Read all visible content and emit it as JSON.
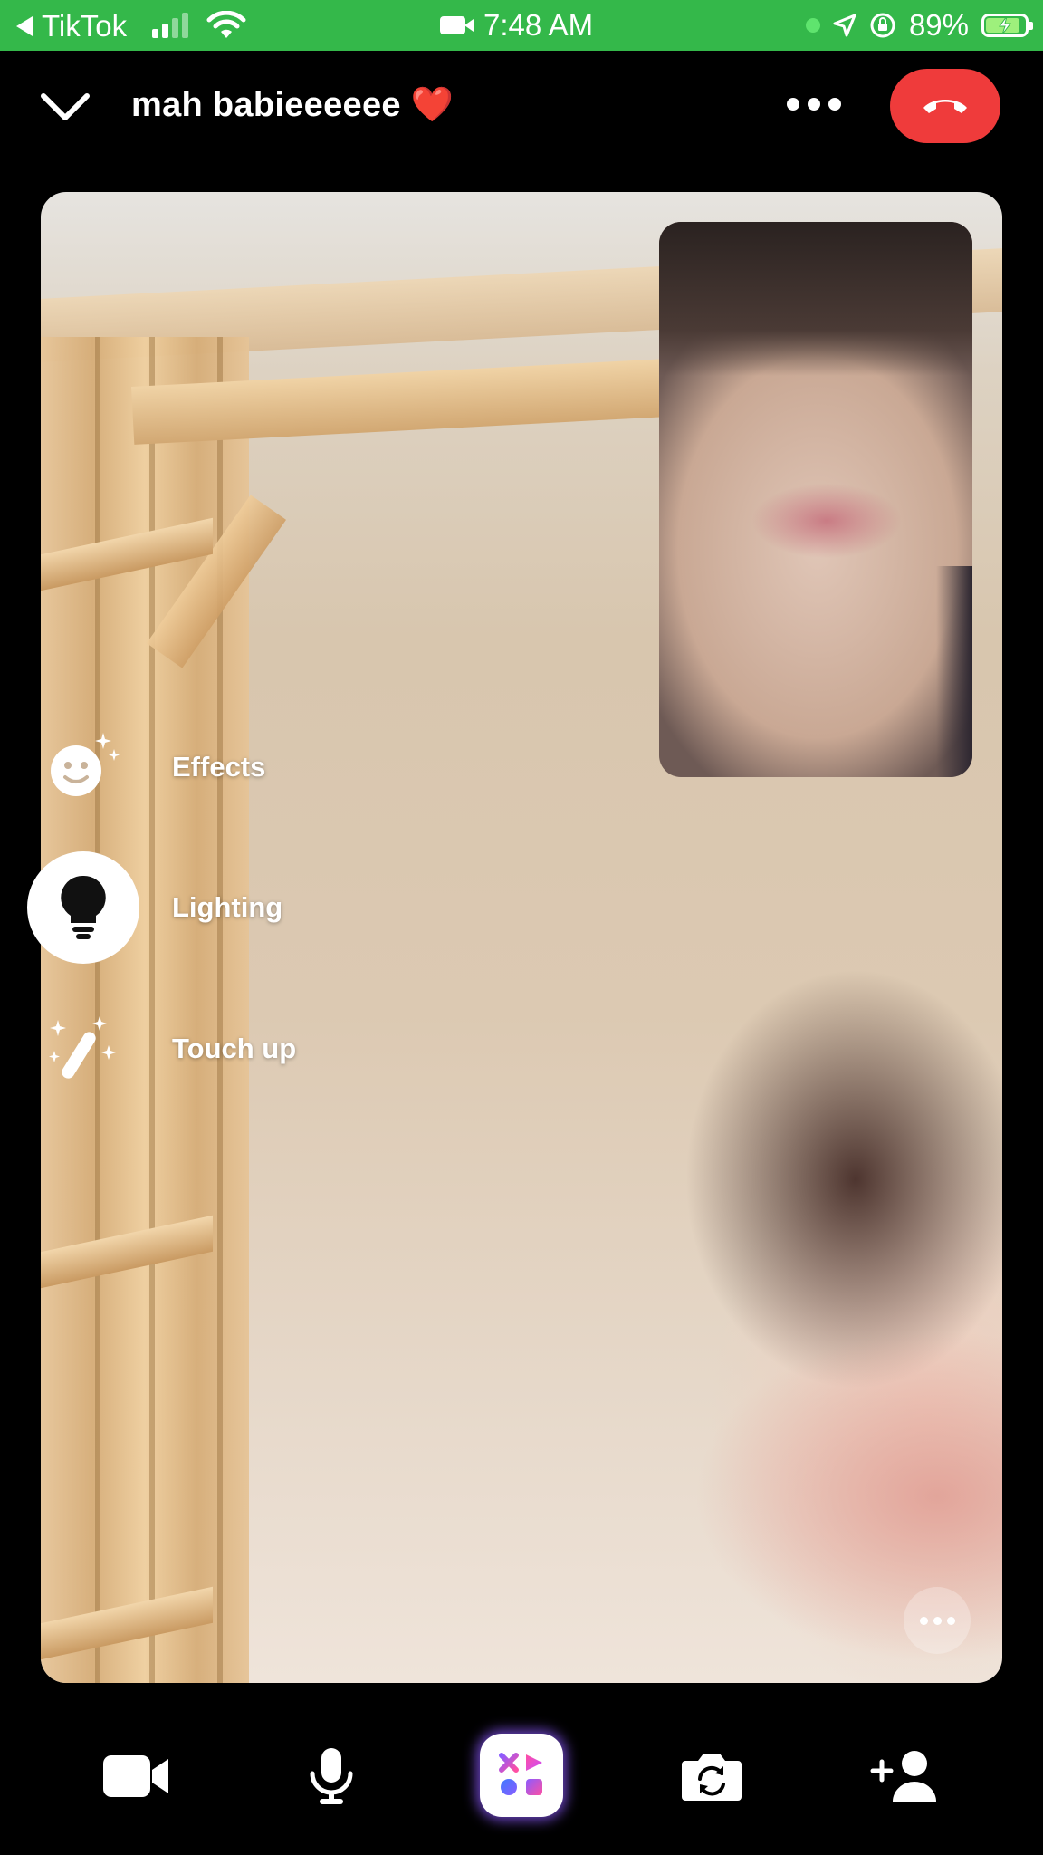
{
  "status_bar": {
    "back_app": "TikTok",
    "time": "7:48 AM",
    "battery": "89%",
    "icons": [
      "signal-icon",
      "wifi-icon",
      "video-indicator-icon",
      "location-icon",
      "orientation-lock-icon",
      "battery-charging-icon"
    ],
    "color": "#34b84a"
  },
  "header": {
    "title": "mah babieeeeee ❤️",
    "collapse_icon": "chevron-down-icon",
    "more_icon": "more-horizontal-icon",
    "end_call_icon": "hang-up-icon",
    "end_call_color": "#ef3b3b"
  },
  "effects_menu": {
    "items": [
      {
        "label": "Effects",
        "icon": "smiley-sparkle-icon",
        "active": false
      },
      {
        "label": "Lighting",
        "icon": "lightbulb-icon",
        "active": true
      },
      {
        "label": "Touch up",
        "icon": "magic-wand-icon",
        "active": false
      }
    ]
  },
  "video": {
    "more_icon": "more-horizontal-icon"
  },
  "bottom_bar": {
    "buttons": [
      {
        "name": "camera-toggle",
        "icon": "video-camera-icon"
      },
      {
        "name": "microphone-toggle",
        "icon": "microphone-icon"
      },
      {
        "name": "apps",
        "icon": "apps-grid-icon"
      },
      {
        "name": "flip-camera",
        "icon": "flip-camera-icon"
      },
      {
        "name": "add-person",
        "icon": "add-person-icon"
      }
    ]
  }
}
